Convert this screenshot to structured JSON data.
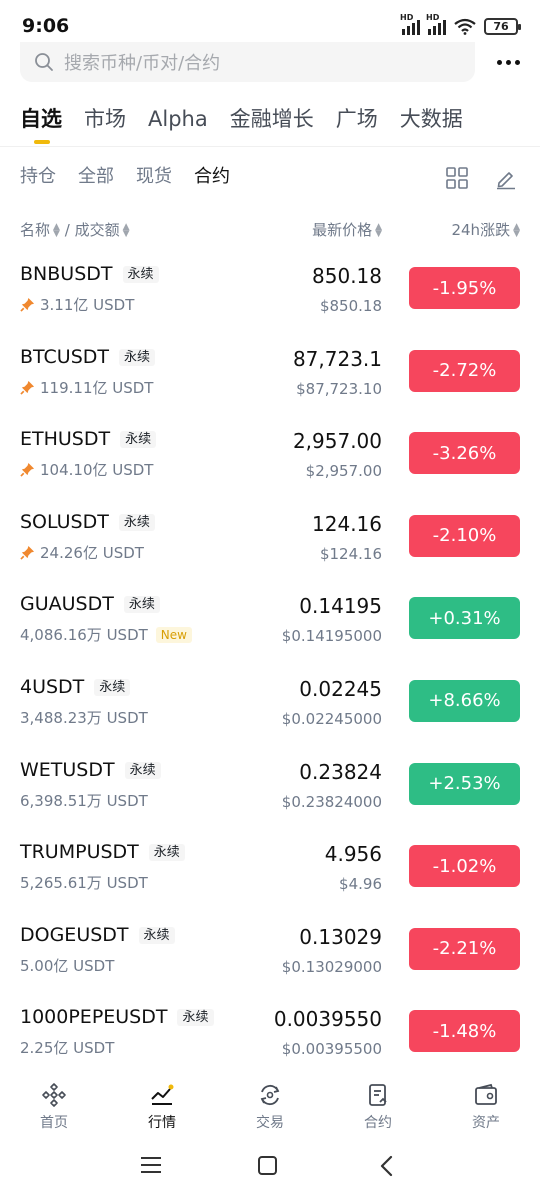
{
  "status": {
    "time": "9:06",
    "battery": "76",
    "hd1": "HD",
    "hd2": "HD"
  },
  "search": {
    "placeholder": "搜索币种/币对/合约"
  },
  "main_tabs": [
    "自选",
    "市场",
    "Alpha",
    "金融增长",
    "广场",
    "大数据"
  ],
  "sub_tabs": [
    "持仓",
    "全部",
    "现货",
    "合约"
  ],
  "columns": {
    "name": "名称",
    "sep": "/",
    "volume": "成交额",
    "price": "最新价格",
    "change": "24h涨跌"
  },
  "rows": [
    {
      "symbol": "BNBUSDT",
      "tag": "永续",
      "volume": "3.11亿 USDT",
      "pinned": true,
      "new": false,
      "price": "850.18",
      "fiat": "$850.18",
      "change": "-1.95%",
      "dir": "down"
    },
    {
      "symbol": "BTCUSDT",
      "tag": "永续",
      "volume": "119.11亿 USDT",
      "pinned": true,
      "new": false,
      "price": "87,723.1",
      "fiat": "$87,723.10",
      "change": "-2.72%",
      "dir": "down"
    },
    {
      "symbol": "ETHUSDT",
      "tag": "永续",
      "volume": "104.10亿 USDT",
      "pinned": true,
      "new": false,
      "price": "2,957.00",
      "fiat": "$2,957.00",
      "change": "-3.26%",
      "dir": "down"
    },
    {
      "symbol": "SOLUSDT",
      "tag": "永续",
      "volume": "24.26亿 USDT",
      "pinned": true,
      "new": false,
      "price": "124.16",
      "fiat": "$124.16",
      "change": "-2.10%",
      "dir": "down"
    },
    {
      "symbol": "GUAUSDT",
      "tag": "永续",
      "volume": "4,086.16万 USDT",
      "pinned": false,
      "new": true,
      "new_label": "New",
      "price": "0.14195",
      "fiat": "$0.14195000",
      "change": "+0.31%",
      "dir": "up"
    },
    {
      "symbol": "4USDT",
      "tag": "永续",
      "volume": "3,488.23万 USDT",
      "pinned": false,
      "new": false,
      "price": "0.02245",
      "fiat": "$0.02245000",
      "change": "+8.66%",
      "dir": "up"
    },
    {
      "symbol": "WETUSDT",
      "tag": "永续",
      "volume": "6,398.51万 USDT",
      "pinned": false,
      "new": false,
      "price": "0.23824",
      "fiat": "$0.23824000",
      "change": "+2.53%",
      "dir": "up"
    },
    {
      "symbol": "TRUMPUSDT",
      "tag": "永续",
      "volume": "5,265.61万 USDT",
      "pinned": false,
      "new": false,
      "price": "4.956",
      "fiat": "$4.96",
      "change": "-1.02%",
      "dir": "down"
    },
    {
      "symbol": "DOGEUSDT",
      "tag": "永续",
      "volume": "5.00亿 USDT",
      "pinned": false,
      "new": false,
      "price": "0.13029",
      "fiat": "$0.13029000",
      "change": "-2.21%",
      "dir": "down"
    },
    {
      "symbol": "1000PEPEUSDT",
      "tag": "永续",
      "volume": "2.25亿 USDT",
      "pinned": false,
      "new": false,
      "price": "0.0039550",
      "fiat": "$0.00395500",
      "change": "-1.48%",
      "dir": "down"
    }
  ],
  "bottom_nav": [
    "首页",
    "行情",
    "交易",
    "合约",
    "资产"
  ],
  "colors": {
    "up": "#2ebd85",
    "down": "#f6465d",
    "accent": "#f0b90b"
  }
}
